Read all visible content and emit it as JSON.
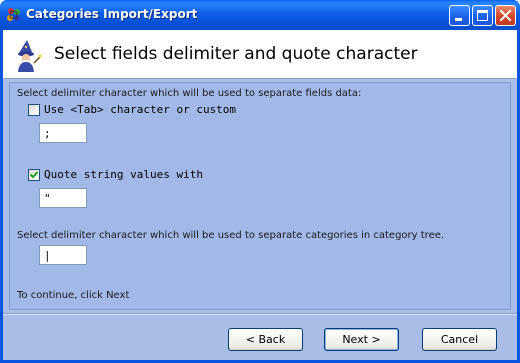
{
  "window": {
    "title": "Categories Import/Export"
  },
  "header": {
    "title": "Select fields delimiter and quote character"
  },
  "form": {
    "delimiter_description": "Select delimiter character which will be used to separate fields data:",
    "use_tab_label": "Use <Tab> character or custom",
    "use_tab_checked": false,
    "delimiter_value": ";",
    "quote_label": "Quote string values with",
    "quote_checked": true,
    "quote_value": "\"",
    "category_delimiter_description": "Select delimiter character which will be used to separate categories in category tree.",
    "category_delimiter_value": "|",
    "continue_hint": "To continue, click Next"
  },
  "buttons": {
    "back_label": "< Back",
    "next_label": "Next >",
    "cancel_label": "Cancel"
  },
  "icons": {
    "app": "app-icon",
    "wizard": "wizard-icon",
    "minimize": "minimize-icon",
    "maximize": "maximize-icon",
    "close": "close-icon",
    "check": "checkmark-icon"
  },
  "colors": {
    "titlebar": "#0a55e0",
    "client_background": "#a9bde6",
    "header_background": "#ffffff",
    "checkmark": "#21a121"
  }
}
